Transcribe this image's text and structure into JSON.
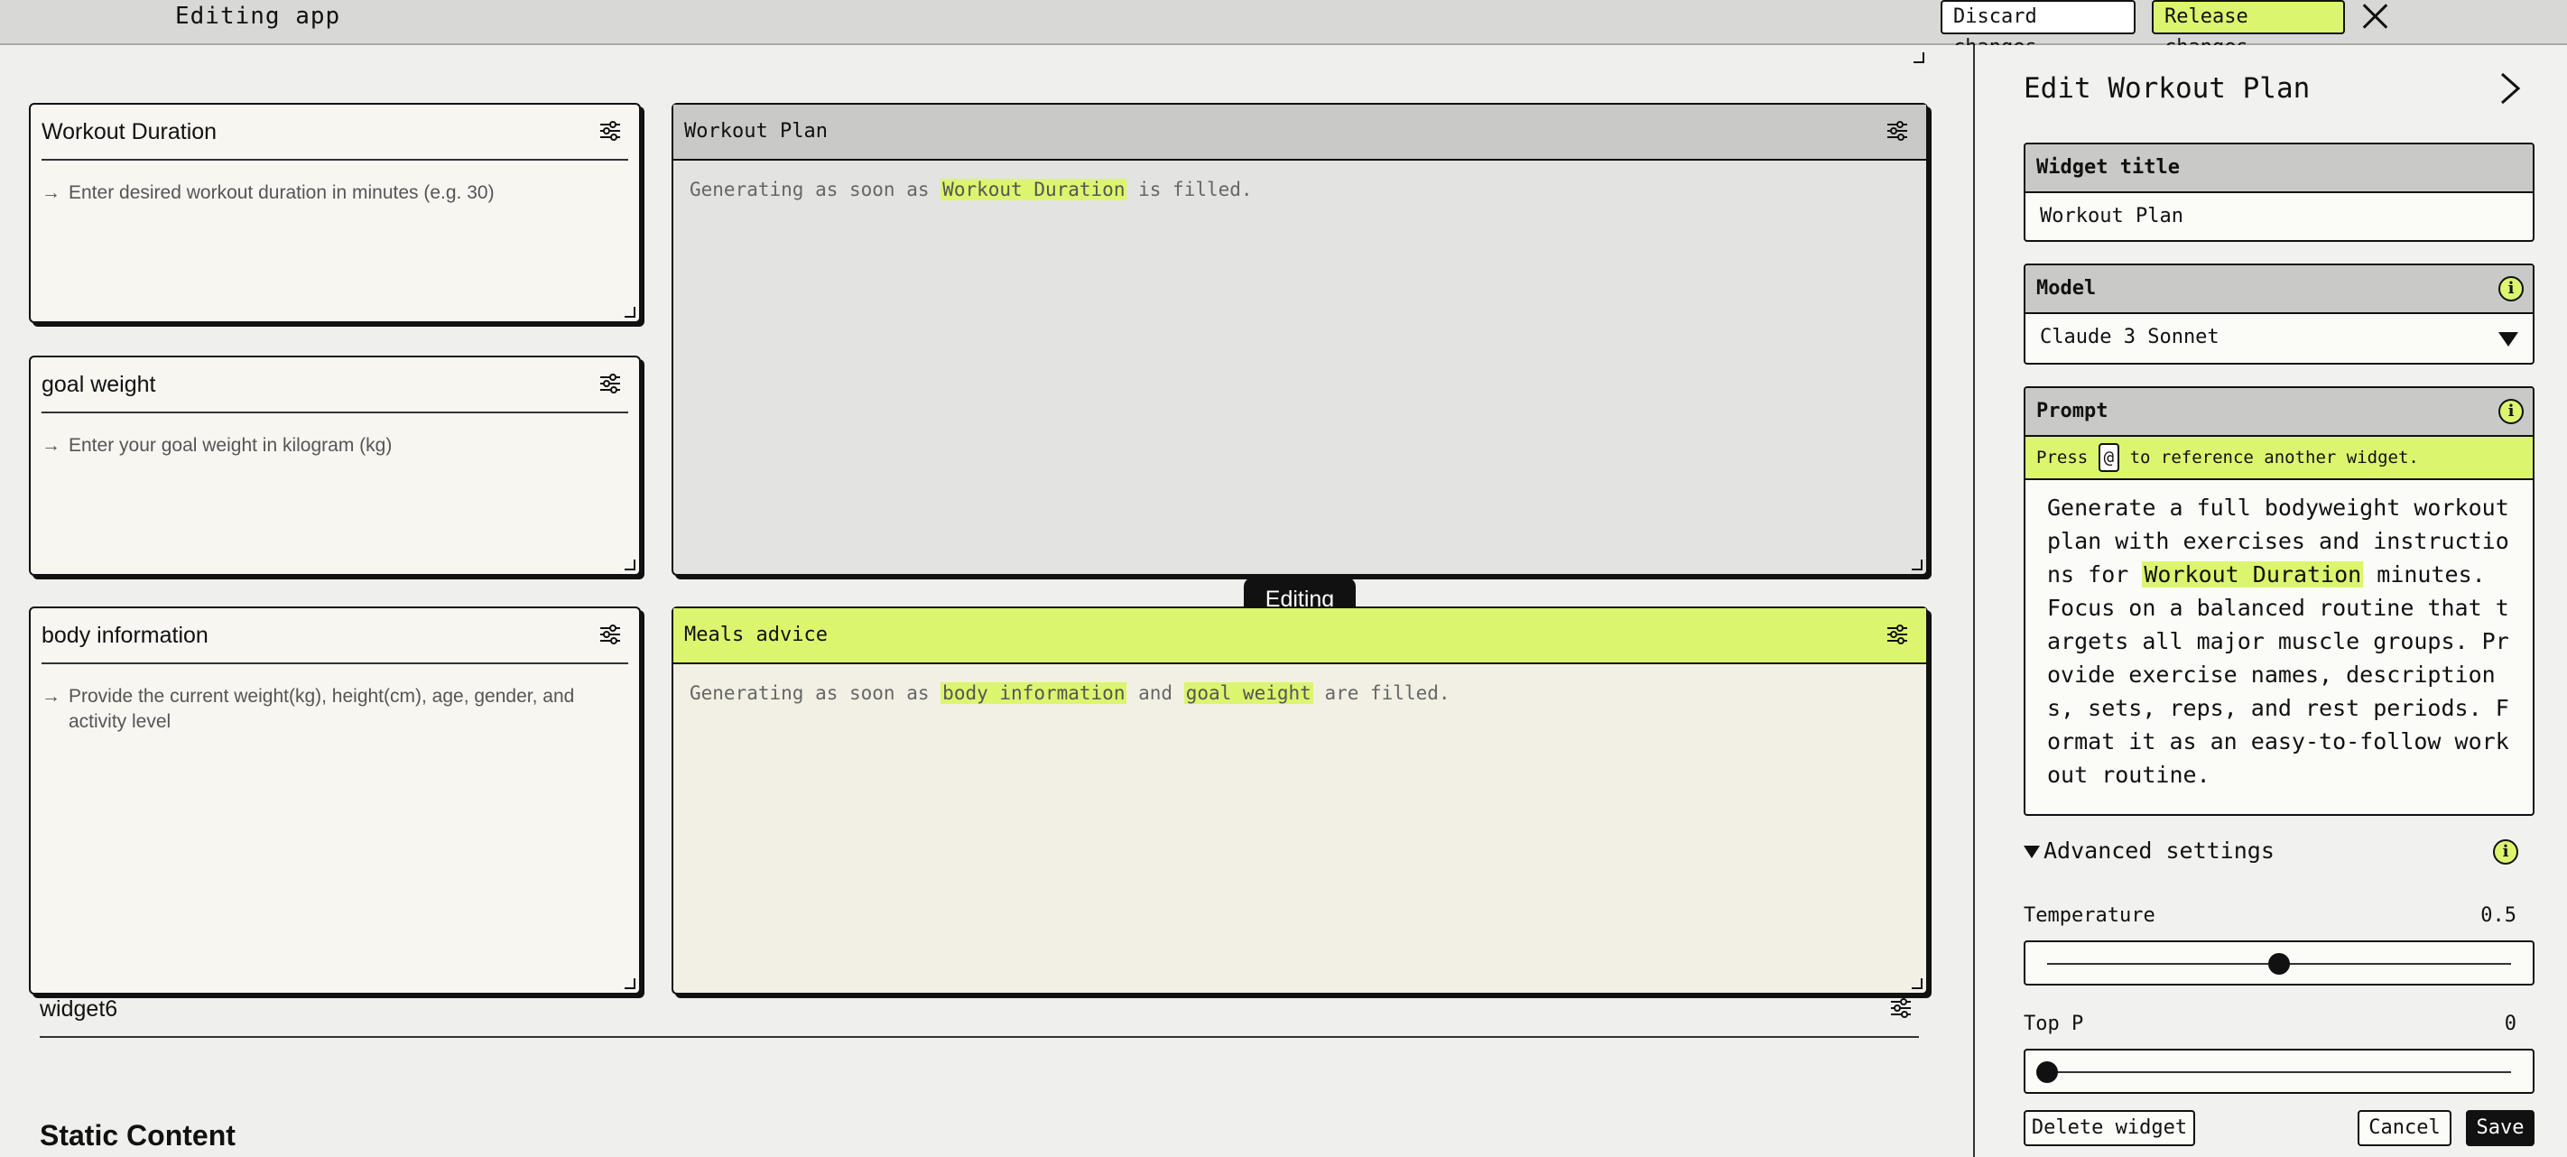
{
  "topbar": {
    "title": "Editing app",
    "discard_label": "Discard changes",
    "release_label": "Release changes"
  },
  "widgets": {
    "duration": {
      "title": "Workout Duration",
      "hint": "Enter desired workout duration in minutes (e.g. 30)"
    },
    "goal": {
      "title": "goal weight",
      "hint": "Enter your goal weight in kilogram (kg)"
    },
    "body": {
      "title": "body information",
      "hint": "Provide the current weight(kg), height(cm), age, gender, and activity level"
    },
    "workout_plan": {
      "title": "Workout Plan",
      "gen_prefix": "Generating as soon as",
      "ref1": "Workout Duration",
      "gen_suffix": "is filled."
    },
    "meals": {
      "title": "Meals advice",
      "gen_prefix": "Generating as soon as",
      "ref1": "body information",
      "joiner": "and",
      "ref2": "goal weight",
      "gen_suffix": "are filled."
    },
    "widget6": {
      "title": "widget6"
    },
    "static": {
      "title": "Static Content"
    }
  },
  "editing_tag": "Editing",
  "panel": {
    "title": "Edit Workout Plan",
    "widget_title_label": "Widget title",
    "widget_title_value": "Workout Plan",
    "model_label": "Model",
    "model_value": "Claude 3 Sonnet",
    "prompt_label": "Prompt",
    "press_text_1": "Press",
    "press_key": "@",
    "press_text_2": "to reference another widget.",
    "prompt_part1": "Generate a full bodyweight workout plan with exercises and instructions for",
    "prompt_ref": "Workout Duration",
    "prompt_part2": "minutes. Focus on a balanced routine that targets all major muscle groups. Provide exercise names, descriptions, sets, reps, and rest periods. Format it as an easy-to-follow workout routine.",
    "advanced_label": "Advanced settings",
    "temperature_label": "Temperature",
    "temperature_value": "0.5",
    "temperature_fraction": 0.5,
    "top_p_label": "Top P",
    "top_p_value": "0",
    "top_p_fraction": 0,
    "delete_label": "Delete widget",
    "cancel_label": "Cancel",
    "save_label": "Save"
  },
  "icons": {
    "close": "close-icon",
    "settings": "sliders-icon",
    "info": "info-icon",
    "collapse": "chevron-right-icon",
    "dropdown": "triangle-down-icon"
  },
  "colors": {
    "accent": "#dcf56f",
    "dark": "#111111"
  }
}
